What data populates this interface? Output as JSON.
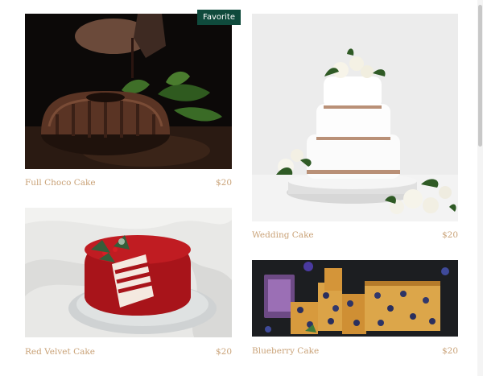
{
  "badge": {
    "label": "Favorite"
  },
  "products": [
    {
      "name": "Full Choco Cake",
      "price": "$20"
    },
    {
      "name": "Wedding Cake",
      "price": "$20"
    },
    {
      "name": "Red Velvet Cake",
      "price": "$20"
    },
    {
      "name": "Blueberry Cake",
      "price": "$20"
    }
  ],
  "colors": {
    "caption": "#c9a277",
    "badge_bg": "#0f4a3c",
    "badge_text": "#ffffff"
  }
}
